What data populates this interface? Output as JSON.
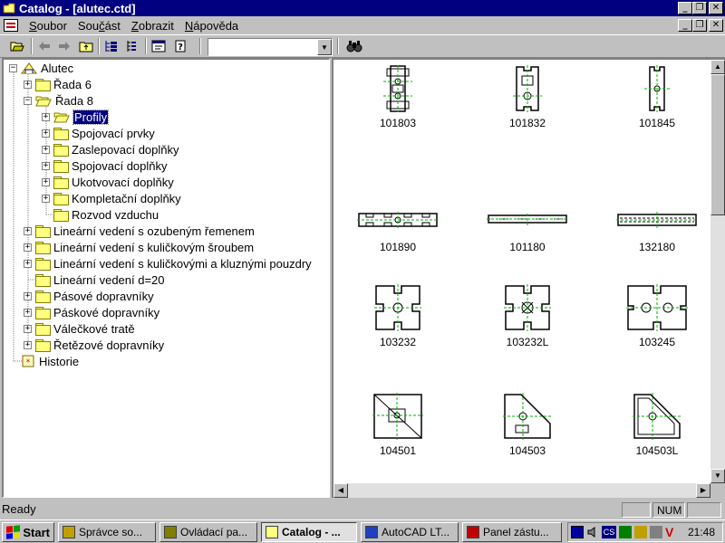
{
  "window": {
    "title": "Catalog - [alutec.ctd]"
  },
  "menu": [
    {
      "accel": "S",
      "rest": "oubor"
    },
    {
      "accel": "",
      "pre": "Sou",
      "ul": "č",
      "rest": "ást"
    },
    {
      "accel": "Z",
      "rest": "obrazit"
    },
    {
      "accel": "N",
      "rest": "ápověda"
    }
  ],
  "toolbar": {
    "search_value": "",
    "icons": [
      "open-icon",
      "back-icon",
      "forward-icon",
      "up-folder-icon",
      "tree-view-icon",
      "list-view-icon",
      "properties-icon",
      "help-icon",
      "find-icon"
    ]
  },
  "tree": [
    {
      "label": "Alutec",
      "level": 0,
      "expander": "−",
      "icon": "catalog-root-icon"
    },
    {
      "label": "Řada 6",
      "level": 1,
      "expander": "+",
      "icon": "folder-icon"
    },
    {
      "label": "Řada 8",
      "level": 1,
      "expander": "−",
      "icon": "folder-open-icon"
    },
    {
      "label": "Profily",
      "level": 2,
      "expander": "+",
      "icon": "folder-open-icon",
      "selected": true
    },
    {
      "label": "Spojovací prvky",
      "level": 2,
      "expander": "+",
      "icon": "folder-icon"
    },
    {
      "label": "Zaslepovací doplňky",
      "level": 2,
      "expander": "+",
      "icon": "folder-icon"
    },
    {
      "label": "Spojovací doplňky",
      "level": 2,
      "expander": "+",
      "icon": "folder-icon"
    },
    {
      "label": "Ukotvovací doplňky",
      "level": 2,
      "expander": "+",
      "icon": "folder-icon"
    },
    {
      "label": "Kompletační doplňky",
      "level": 2,
      "expander": "+",
      "icon": "folder-icon"
    },
    {
      "label": "Rozvod vzduchu",
      "level": 2,
      "expander": "",
      "icon": "folder-icon"
    },
    {
      "label": "Lineární vedení s ozubeným řemenem",
      "level": 1,
      "expander": "+",
      "icon": "folder-icon"
    },
    {
      "label": "Lineární vedení s kuličkovým šroubem",
      "level": 1,
      "expander": "+",
      "icon": "folder-icon"
    },
    {
      "label": "Lineární vedení s kuličkovými a kluznými pouzdry",
      "level": 1,
      "expander": "+",
      "icon": "folder-icon"
    },
    {
      "label": "Lineární vedení d=20",
      "level": 1,
      "expander": "",
      "icon": "folder-icon"
    },
    {
      "label": "Pásové dopravníky",
      "level": 1,
      "expander": "+",
      "icon": "folder-icon"
    },
    {
      "label": "Páskové dopravníky",
      "level": 1,
      "expander": "+",
      "icon": "folder-icon"
    },
    {
      "label": "Válečkové tratě",
      "level": 1,
      "expander": "+",
      "icon": "folder-icon"
    },
    {
      "label": "Řetězové dopravníky",
      "level": 1,
      "expander": "+",
      "icon": "folder-icon"
    },
    {
      "label": "Historie",
      "level": 0,
      "expander": "",
      "icon": "history-icon"
    }
  ],
  "profiles": [
    {
      "code": "101803",
      "shape": "narrow-double"
    },
    {
      "code": "101832",
      "shape": "narrow-single"
    },
    {
      "code": "101845",
      "shape": "narrow-slim"
    },
    {
      "code": "101890",
      "shape": "flat-wide"
    },
    {
      "code": "101180",
      "shape": "flat-thin"
    },
    {
      "code": "132180",
      "shape": "flat-thin-b"
    },
    {
      "code": "103232",
      "shape": "square"
    },
    {
      "code": "103232L",
      "shape": "square-light"
    },
    {
      "code": "103245",
      "shape": "wide-square"
    },
    {
      "code": "104501",
      "shape": "corner-square"
    },
    {
      "code": "104503",
      "shape": "corner-chamfer"
    },
    {
      "code": "104503L",
      "shape": "corner-chamfer-light"
    }
  ],
  "status": {
    "text": "Ready",
    "num": "NUM"
  },
  "taskbar": {
    "start": "Start",
    "tasks": [
      {
        "label": "Správce so...",
        "icon": "file-manager-icon",
        "color": "#c0a000"
      },
      {
        "label": "Ovládací pa...",
        "icon": "control-panel-icon",
        "color": "#808000"
      },
      {
        "label": "Catalog - ...",
        "icon": "catalog-icon",
        "color": "#ffff80",
        "active": true
      },
      {
        "label": "AutoCAD LT...",
        "icon": "autocad-icon",
        "color": "#2040c0"
      },
      {
        "label": "Panel zástu...",
        "icon": "panel-icon",
        "color": "#c00000"
      }
    ],
    "tray_icons": [
      "monitor-icon",
      "speaker-icon",
      "language-cs-icon",
      "network-icon",
      "printer-icon",
      "tool-icon",
      "antivirus-icon"
    ],
    "tray_lang": "CS",
    "clock": "21:48"
  },
  "colors": {
    "title_bg": "#000080",
    "accent_green": "#00b000",
    "selection": "#000080"
  }
}
